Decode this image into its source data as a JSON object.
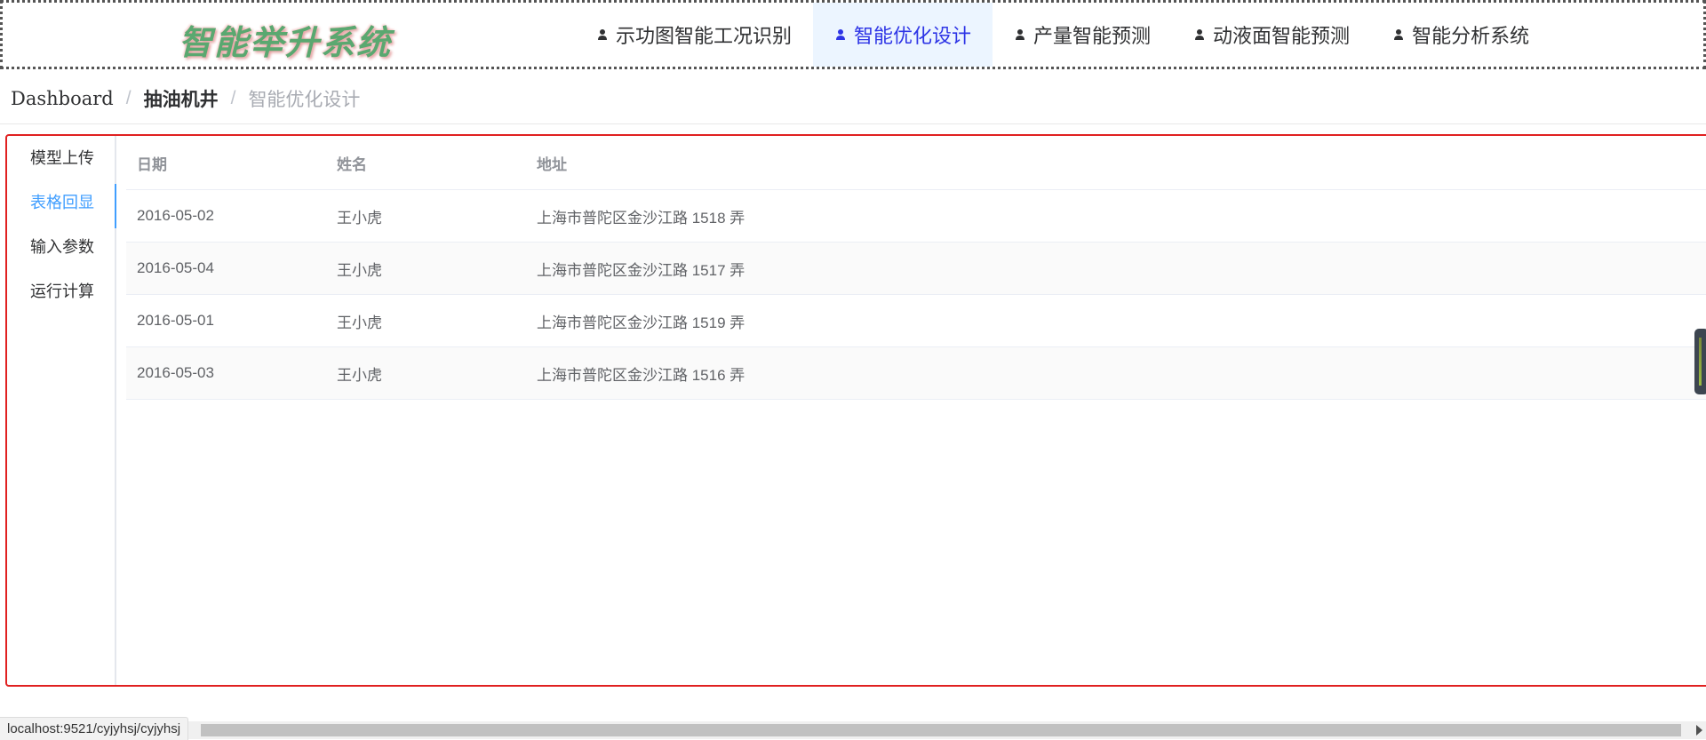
{
  "header": {
    "logo_text": "智能举升系统",
    "nav": [
      {
        "label": "示功图智能工况识别",
        "active": false
      },
      {
        "label": "智能优化设计",
        "active": true
      },
      {
        "label": "产量智能预测",
        "active": false
      },
      {
        "label": "动液面智能预测",
        "active": false
      },
      {
        "label": "智能分析系统",
        "active": false
      }
    ]
  },
  "breadcrumb": {
    "items": [
      "Dashboard",
      "抽油机井",
      "智能优化设计"
    ],
    "separator": "/"
  },
  "side_tabs": [
    {
      "label": "模型上传",
      "active": false
    },
    {
      "label": "表格回显",
      "active": true
    },
    {
      "label": "输入参数",
      "active": false
    },
    {
      "label": "运行计算",
      "active": false
    }
  ],
  "table": {
    "headers": [
      "日期",
      "姓名",
      "地址"
    ],
    "rows": [
      [
        "2016-05-02",
        "王小虎",
        "上海市普陀区金沙江路 1518 弄"
      ],
      [
        "2016-05-04",
        "王小虎",
        "上海市普陀区金沙江路 1517 弄"
      ],
      [
        "2016-05-01",
        "王小虎",
        "上海市普陀区金沙江路 1519 弄"
      ],
      [
        "2016-05-03",
        "王小虎",
        "上海市普陀区金沙江路 1516 弄"
      ]
    ]
  },
  "status_bar": {
    "url": "localhost:9521/cyjyhsj/cyjyhsj"
  },
  "colors": {
    "nav_active_bg": "#ecf5ff",
    "nav_active_text": "#2e35e6",
    "tab_active": "#409eff",
    "panel_border": "#e02020"
  },
  "icons": {
    "nav_item": "user-icon"
  }
}
